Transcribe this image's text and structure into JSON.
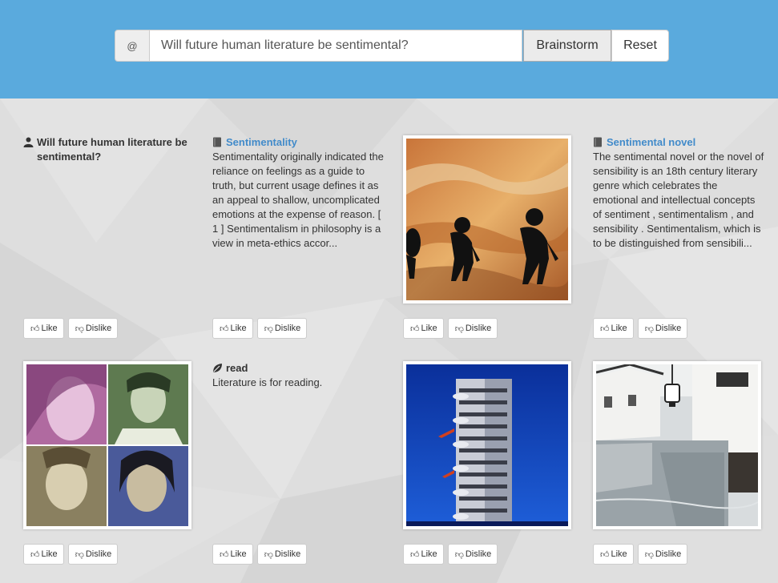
{
  "search": {
    "addon": "@",
    "query": "Will future human literature be sentimental?",
    "brainstorm_label": "Brainstorm",
    "reset_label": "Reset"
  },
  "cards": [
    {
      "title": "Will future human literature be sentimental?",
      "icon": "user-icon"
    },
    {
      "title": "Sentimentality",
      "icon": "book-icon",
      "desc": "Sentimentality originally indicated the reliance on feelings as a guide to truth, but current usage defines it as an appeal to shallow, uncomplicated emotions at the expense of reason. [ 1 ] Sentimentalism in philosophy is a view in meta-ethics accor..."
    },
    {
      "image": "human-evolution-silhouettes"
    },
    {
      "title": "Sentimental novel",
      "icon": "book-icon",
      "desc": "The sentimental novel or the novel of sensibility is an 18th century literary genre which celebrates the emotional and intellectual concepts of sentiment , sentimentalism , and sensibility . Sentimentalism, which is to be distinguished from sensibili..."
    },
    {
      "image": "emotional-faces-collage"
    },
    {
      "title": "read",
      "icon": "leaf-icon",
      "desc": "Literature is for reading."
    },
    {
      "image": "modern-tower-building"
    },
    {
      "image": "canal-town-lantern"
    }
  ],
  "actions": {
    "like": "Like",
    "dislike": "Dislike"
  },
  "colors": {
    "header": "#5aaadd",
    "link": "#428bca",
    "background": "#dcdcdc"
  }
}
